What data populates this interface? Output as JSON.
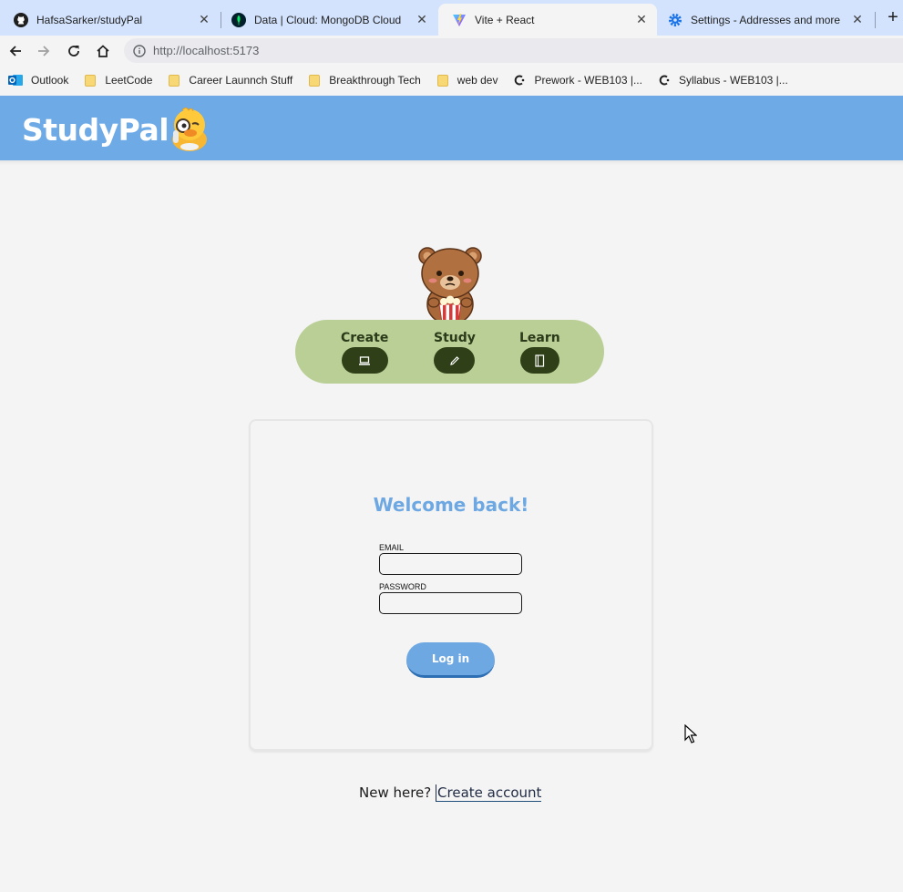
{
  "browser": {
    "tabs": [
      {
        "title": "HafsaSarker/studyPal",
        "icon": "github-icon",
        "active": false
      },
      {
        "title": "Data | Cloud: MongoDB Cloud",
        "icon": "mongodb-leaf-icon",
        "active": false
      },
      {
        "title": "Vite + React",
        "icon": "vite-icon",
        "active": true
      },
      {
        "title": "Settings - Addresses and more",
        "icon": "gear-icon",
        "active": false
      }
    ],
    "new_tab": "+",
    "url": "http://localhost:5173",
    "bookmarks": [
      {
        "label": "Outlook",
        "icon": "outlook-icon"
      },
      {
        "label": "LeetCode",
        "icon": "folder-icon"
      },
      {
        "label": "Career Launnch Stuff",
        "icon": "folder-icon"
      },
      {
        "label": "Breakthrough Tech",
        "icon": "folder-icon"
      },
      {
        "label": "web dev",
        "icon": "folder-icon"
      },
      {
        "label": "Prework - WEB103 |...",
        "icon": "codepath-icon"
      },
      {
        "label": "Syllabus - WEB103 |...",
        "icon": "codepath-icon"
      }
    ]
  },
  "app": {
    "logo": "StudyPal",
    "header_color": "#6eaae6",
    "nav": [
      {
        "label": "Create",
        "icon": "laptop-icon"
      },
      {
        "label": "Study",
        "icon": "pencil-icon"
      },
      {
        "label": "Learn",
        "icon": "notebook-icon"
      }
    ],
    "login": {
      "title": "Welcome back!",
      "email_label": "EMAIL",
      "email_value": "",
      "password_label": "PASSWORD",
      "password_value": "",
      "button": "Log in"
    },
    "signup": {
      "prompt": "New here?",
      "link": "Create account"
    },
    "colors": {
      "accent": "#6ea8e2",
      "pill": "#b9cf96",
      "pill_button": "#2f4018"
    }
  }
}
